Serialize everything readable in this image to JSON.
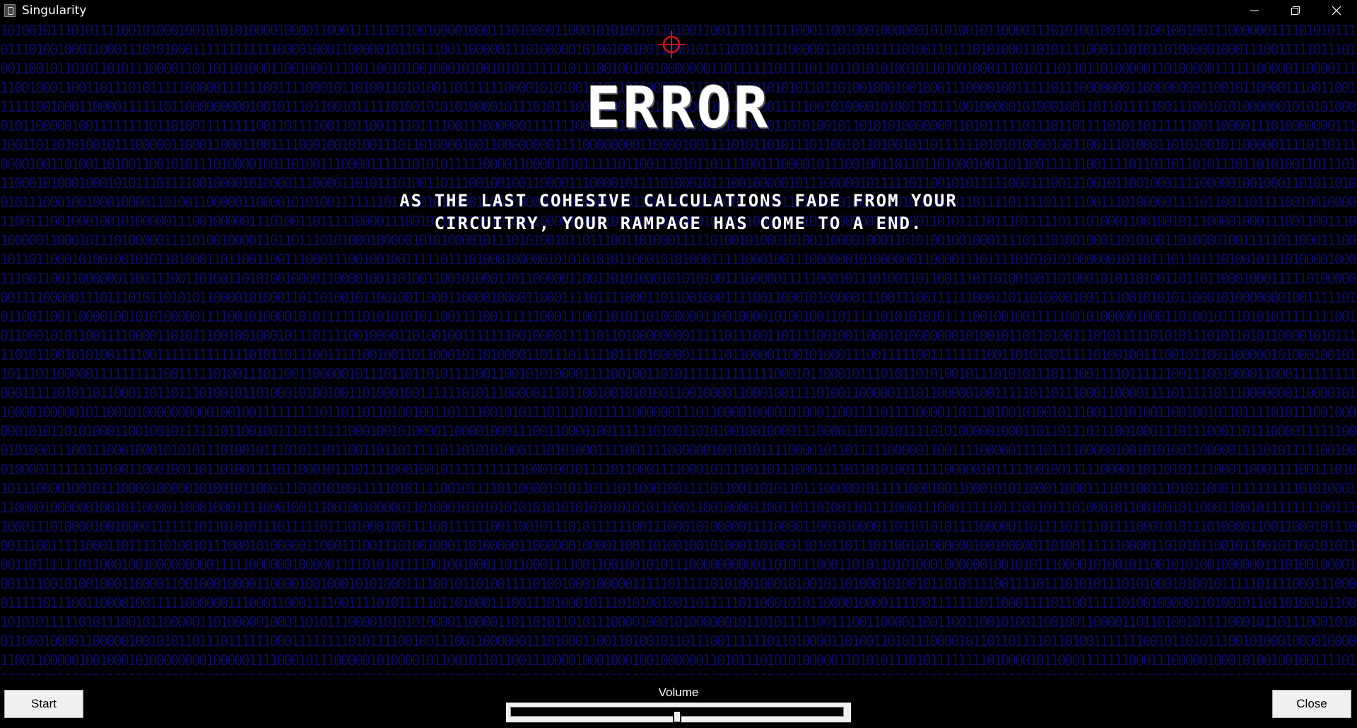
{
  "window": {
    "title": "Singularity",
    "controls": [
      "minimize-icon",
      "restore-icon",
      "close-icon"
    ]
  },
  "game": {
    "background_color": "#0c0c66",
    "crosshair_color": "#d4101a",
    "error_title": "ERROR",
    "error_message_line1": "As the last cohesive calculations fade from your",
    "error_message_line2": "circuitry, your rampage has come to a end."
  },
  "bottombar": {
    "start_label": "Start",
    "volume_label": "Volume",
    "volume_level": 0.5,
    "close_label": "Close"
  }
}
